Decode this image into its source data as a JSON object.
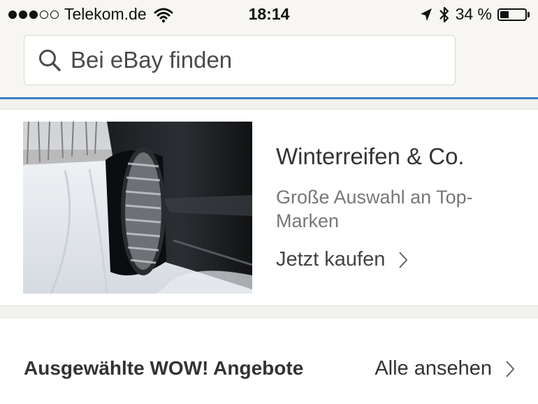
{
  "status_bar": {
    "carrier": "Telekom.de",
    "time": "18:14",
    "battery_text": "34 %",
    "battery_level": 0.34,
    "signal_bars_filled": 3,
    "signal_bars_total": 5
  },
  "search": {
    "placeholder": "Bei eBay finden",
    "icon": "search-icon"
  },
  "promo": {
    "title": "Winterreifen & Co.",
    "subtitle": "Große Auswahl an Top-Marken",
    "cta": "Jetzt kaufen"
  },
  "deals_section": {
    "title": "Ausgewählte WOW! Angebote",
    "link": "Alle ansehen"
  },
  "colors": {
    "accent": "#3d7fc4",
    "background": "#f7f6f3"
  }
}
